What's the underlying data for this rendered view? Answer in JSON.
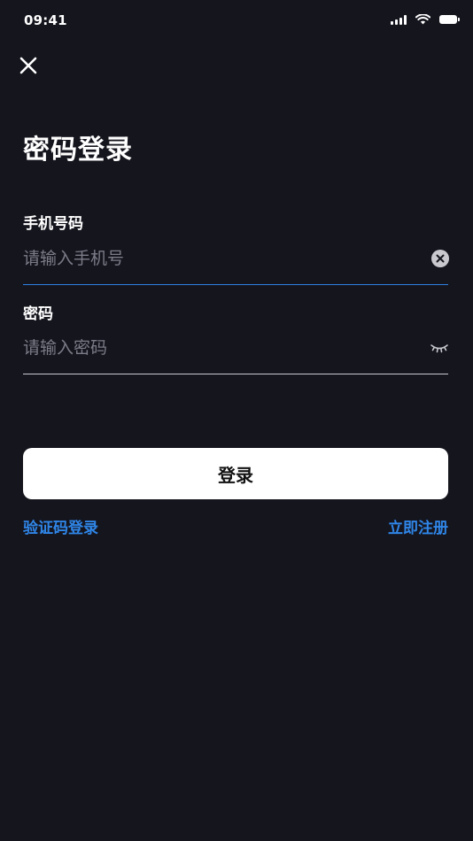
{
  "status_bar": {
    "time": "09:41"
  },
  "header": {
    "close_icon": "close-icon"
  },
  "page": {
    "title": "密码登录"
  },
  "phone_field": {
    "label": "手机号码",
    "placeholder": "请输入手机号",
    "value": "",
    "clear_icon": "clear-icon"
  },
  "password_field": {
    "label": "密码",
    "placeholder": "请输入密码",
    "value": "",
    "toggle_icon": "eye-closed-icon"
  },
  "actions": {
    "login_label": "登录",
    "sms_login_label": "验证码登录",
    "register_label": "立即注册"
  },
  "colors": {
    "background": "#15151e",
    "accent": "#2f86e8",
    "active_underline": "#2f7fe0",
    "placeholder": "#7c7c88"
  }
}
